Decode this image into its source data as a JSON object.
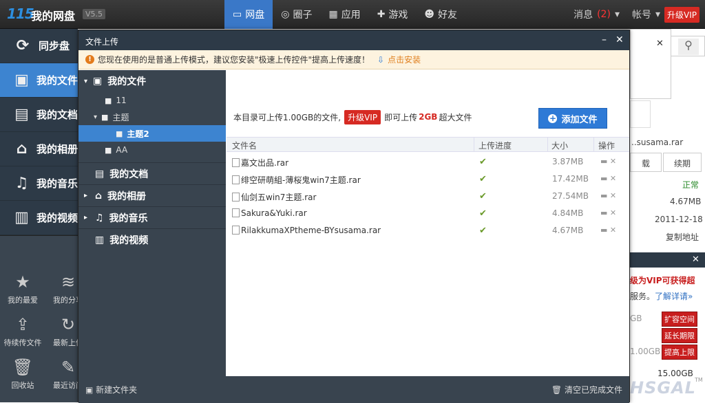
{
  "app": {
    "logo": "115",
    "title": "我的网盘",
    "version": "V5.5"
  },
  "nav": [
    {
      "label": "网盘",
      "icon": "disk-icon",
      "active": true
    },
    {
      "label": "圈子",
      "icon": "circle-icon",
      "active": false
    },
    {
      "label": "应用",
      "icon": "apps-icon",
      "active": false
    },
    {
      "label": "游戏",
      "icon": "gamepad-icon",
      "active": false
    },
    {
      "label": "好友",
      "icon": "friends-icon",
      "active": false
    }
  ],
  "topright": {
    "messages": "消息",
    "msg_count": "(2)",
    "account": "帐号",
    "vip": "升级VIP"
  },
  "leftnav": [
    {
      "label": "同步盘",
      "icon": "sync-icon"
    },
    {
      "label": "我的文件",
      "icon": "briefcase-icon"
    },
    {
      "label": "我的文档",
      "icon": "document-icon"
    },
    {
      "label": "我的相册",
      "icon": "album-icon"
    },
    {
      "label": "我的音乐",
      "icon": "music-icon"
    },
    {
      "label": "我的视频",
      "icon": "video-icon"
    }
  ],
  "leftbottom": [
    {
      "label": "我的最爱",
      "icon": "star-icon"
    },
    {
      "label": "我的分享",
      "icon": "rss-icon"
    },
    {
      "label": "待续传文件",
      "icon": "upload-icon"
    },
    {
      "label": "最新上传",
      "icon": "refresh-upload-icon"
    },
    {
      "label": "回收站",
      "icon": "trash-icon"
    },
    {
      "label": "最近访问",
      "icon": "pin-icon"
    }
  ],
  "dialog": {
    "title": "文件上传",
    "minimize": "–",
    "close": "✕",
    "notice": "您现在使用的是普通上传模式，建议您安装\"极速上传控件\"提高上传速度！",
    "install": "点击安装",
    "tree": {
      "root": "我的文件",
      "sub": [
        {
          "label": "11",
          "selected": false
        },
        {
          "label": "主题",
          "selected": false
        },
        {
          "label": "主题2",
          "selected": true
        },
        {
          "label": "AA",
          "selected": false
        }
      ],
      "sections": [
        "我的文档",
        "我的相册",
        "我的音乐",
        "我的视频"
      ]
    },
    "info": {
      "pre": "本目录可上传1.00GB的文件,",
      "vip": "升级VIP",
      "mid": "即可上传",
      "big": "2GB",
      "post": "超大文件"
    },
    "add_button": "添加文件",
    "columns": {
      "name": "文件名",
      "progress": "上传进度",
      "size": "大小",
      "ops": "操作"
    },
    "files": [
      {
        "name": "嘉文出品.rar",
        "size": "3.87MB"
      },
      {
        "name": "绯空研萌組-薄桜鬼win7主题.rar",
        "size": "17.42MB"
      },
      {
        "name": "仙剑五win7主题.rar",
        "size": "27.54MB"
      },
      {
        "name": "Sakura&Yuki.rar",
        "size": "4.84MB"
      },
      {
        "name": "RilakkumaXPtheme-BYsusama.rar",
        "size": "4.67MB"
      }
    ],
    "new_folder": "新建文件夹",
    "clear_done": "清空已完成文件"
  },
  "right": {
    "filename": "..susama.rar",
    "btn_download": "载",
    "btn_resume": "续期",
    "status": "正常",
    "size": "4.67MB",
    "date": "2011-12-18",
    "copy": "复制地址",
    "vip_promo": "级为VIP可获得超",
    "vip_promo_prefix": "",
    "service": "服务。",
    "learn_more": "了解详请»",
    "quota1": "GB",
    "expand": "扩容空间",
    "extend": "延长期限",
    "raise": "提高上限",
    "quota2": "1.00GB",
    "quota3": "15.00GB",
    "watermark": "HSGAL",
    "tm": "TM"
  }
}
